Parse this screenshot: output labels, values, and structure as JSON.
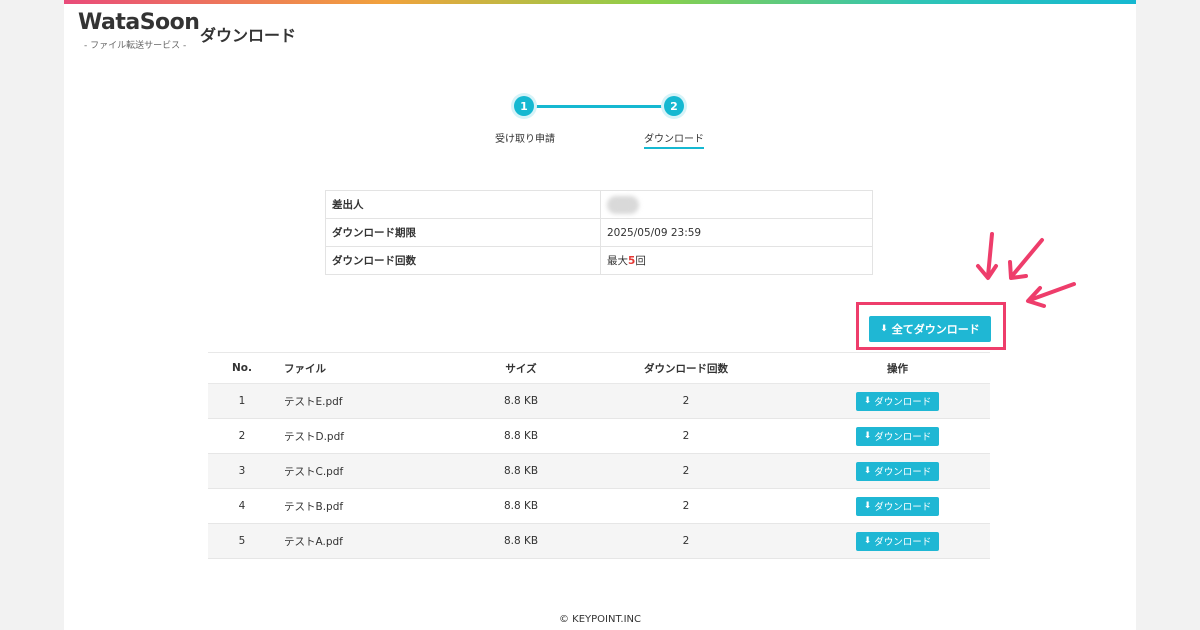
{
  "brand": {
    "logo_text": "WataSoon",
    "logo_sub": "- ファイル転送サービス -",
    "accent": "#1fb7d4"
  },
  "header": {
    "title": "ダウンロード"
  },
  "stepper": {
    "steps": [
      {
        "number": "1",
        "label": "受け取り申請"
      },
      {
        "number": "2",
        "label": "ダウンロード"
      }
    ]
  },
  "info": {
    "sender_label": "差出人",
    "deadline_label": "ダウンロード期限",
    "deadline_value": "2025/05/09 23:59",
    "count_label": "ダウンロード回数",
    "count_prefix": "最大",
    "count_number": "5",
    "count_suffix": "回"
  },
  "download_all_label": "全てダウンロード",
  "files_table": {
    "headers": {
      "no": "No.",
      "file": "ファイル",
      "size": "サイズ",
      "count": "ダウンロード回数",
      "op": "操作"
    },
    "button_label": "ダウンロード",
    "rows": [
      {
        "no": "1",
        "file": "テストE.pdf",
        "size": "8.8 KB",
        "count": "2"
      },
      {
        "no": "2",
        "file": "テストD.pdf",
        "size": "8.8 KB",
        "count": "2"
      },
      {
        "no": "3",
        "file": "テストC.pdf",
        "size": "8.8 KB",
        "count": "2"
      },
      {
        "no": "4",
        "file": "テストB.pdf",
        "size": "8.8 KB",
        "count": "2"
      },
      {
        "no": "5",
        "file": "テストA.pdf",
        "size": "8.8 KB",
        "count": "2"
      }
    ]
  },
  "footer": {
    "copyright": "© KEYPOINT.INC"
  },
  "colors": {
    "highlight": "#ee3d6b",
    "accent": "#1fb7d4",
    "danger": "#e53935"
  }
}
